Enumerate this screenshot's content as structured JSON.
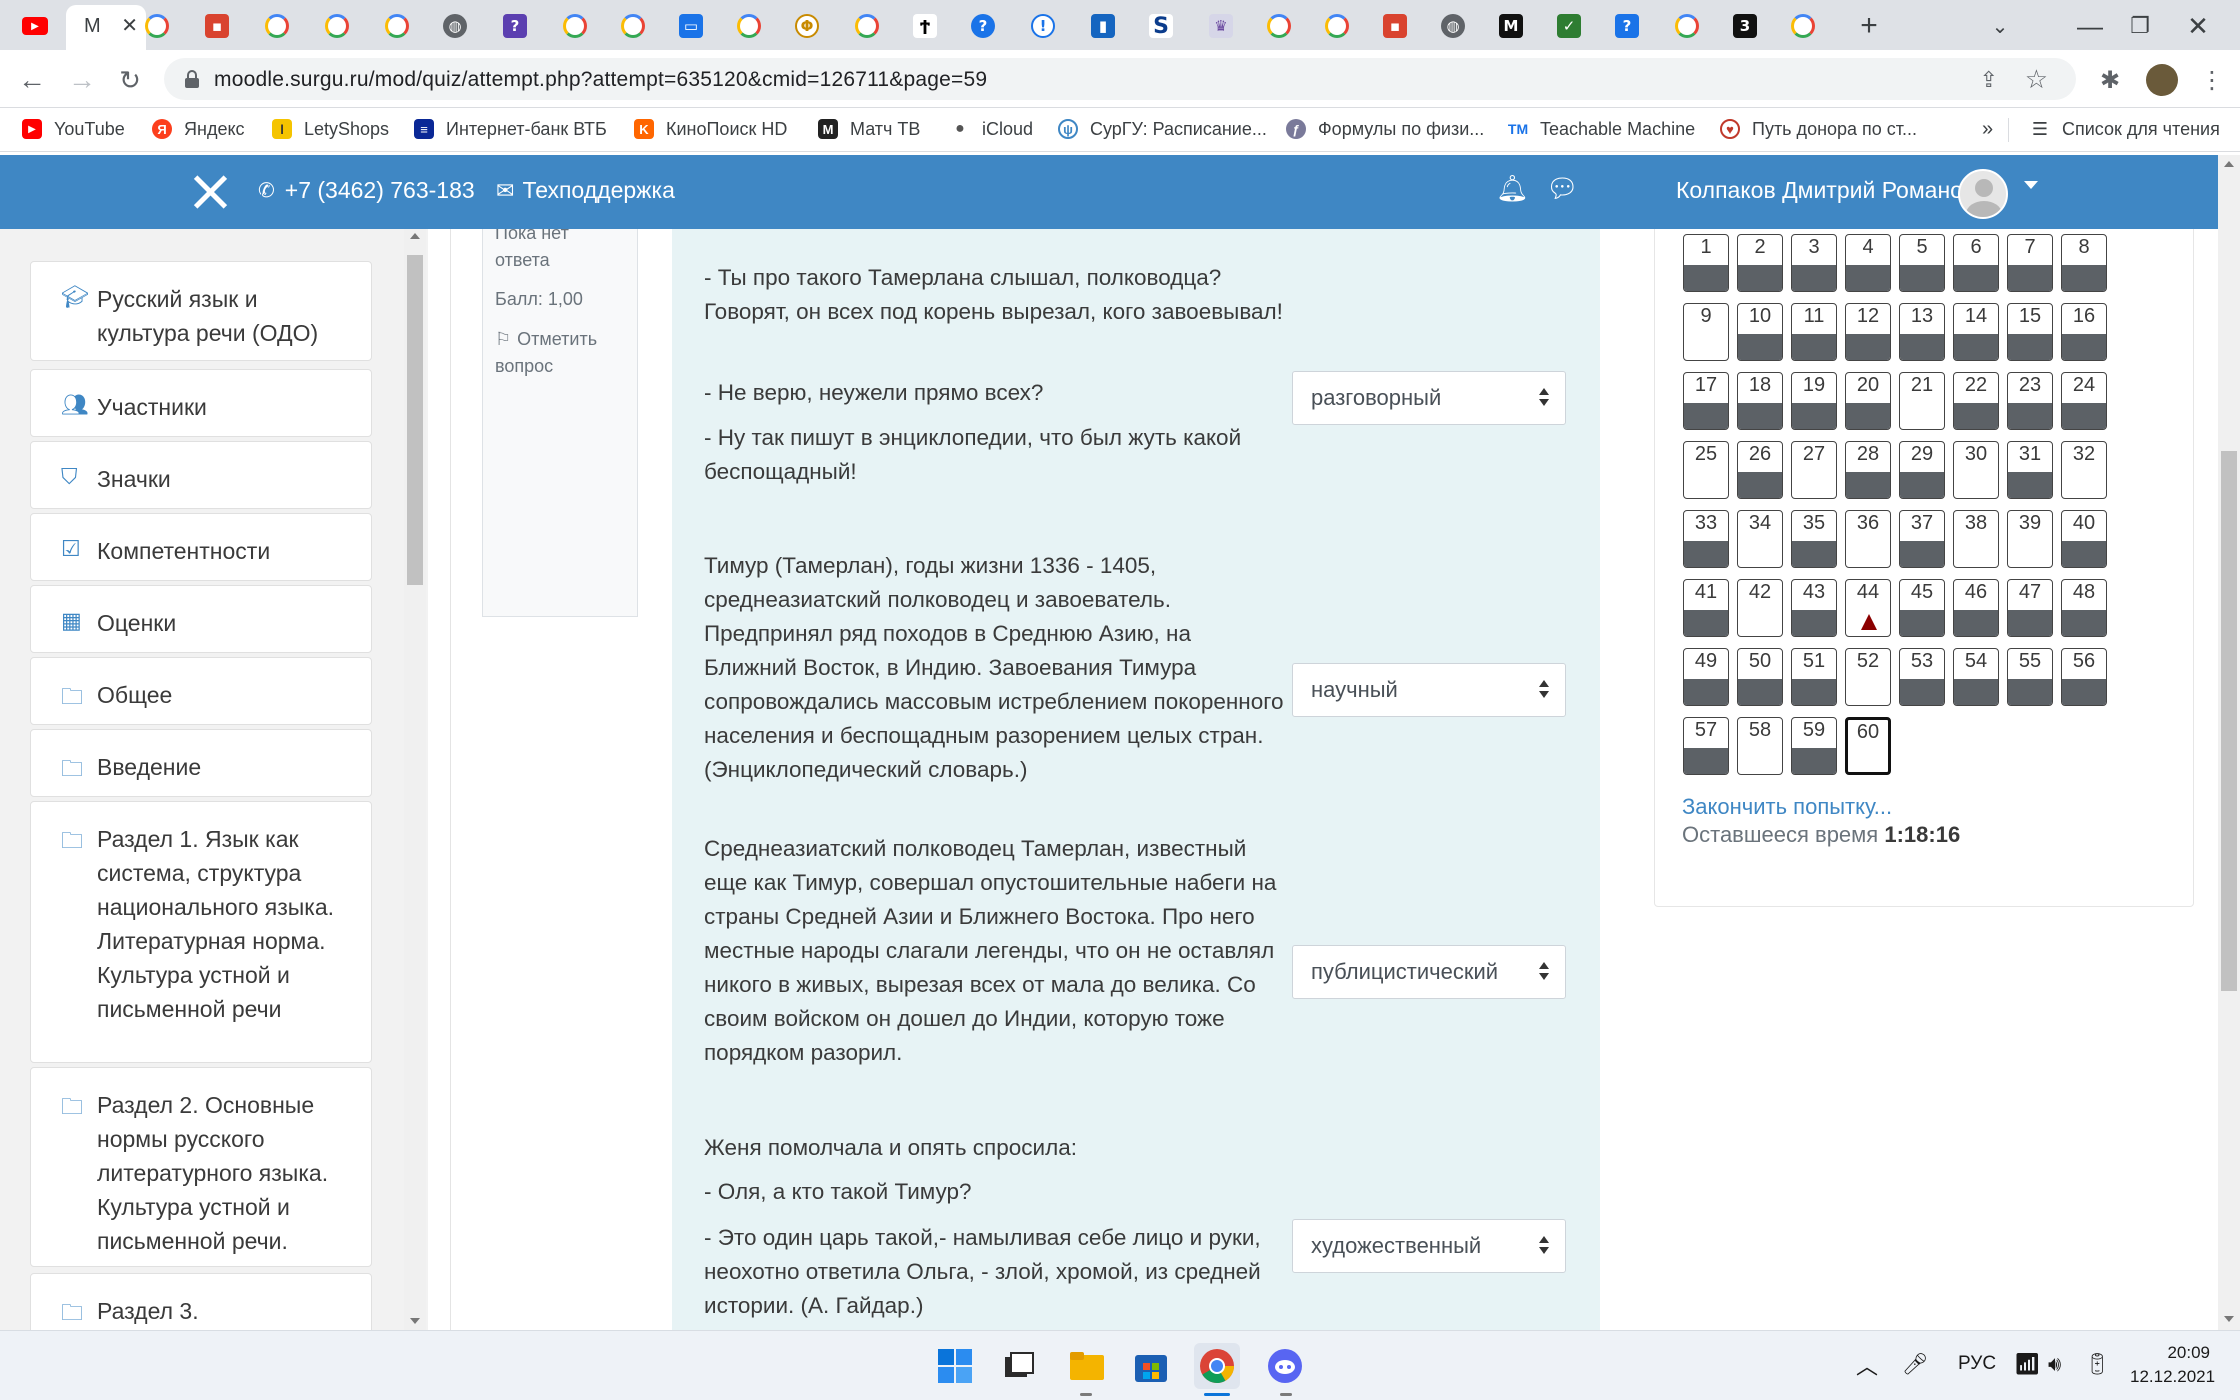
{
  "browser": {
    "url": "moodle.surgu.ru/mod/quiz/attempt.php?attempt=635120&cmid=126711&page=59",
    "active_tab_label": "М",
    "bookmarks": [
      {
        "label": "YouTube",
        "icon": "youtube-icon",
        "color": "#ff0000"
      },
      {
        "label": "Яндекс",
        "icon": "yandex-icon",
        "color": "#fc3f1d"
      },
      {
        "label": "LetyShops",
        "icon": "letyshops-icon",
        "color": "#f5c400"
      },
      {
        "label": "Интернет-банк ВТБ",
        "icon": "vtb-icon",
        "color": "#0a2896"
      },
      {
        "label": "КиноПоиск HD",
        "icon": "kinopoisk-icon",
        "color": "#ff6600"
      },
      {
        "label": "Матч ТВ",
        "icon": "matchtv-icon",
        "color": "#222222"
      },
      {
        "label": "iCloud",
        "icon": "apple-icon",
        "color": "#555555"
      },
      {
        "label": "СурГУ: Расписание...",
        "icon": "surgu-icon",
        "color": "#3f87c4"
      },
      {
        "label": "Формулы по физи...",
        "icon": "formula-icon",
        "color": "#7a7a9a"
      },
      {
        "label": "Teachable Machine",
        "icon": "teachable-icon",
        "color": "#1a73e8"
      },
      {
        "label": "Путь донора по ст...",
        "icon": "donor-icon",
        "color": "#c0392b"
      }
    ],
    "more_bookmarks": "»",
    "reading_list": "Список для чтения"
  },
  "navbar": {
    "phone": "+7 (3462) 763-183",
    "support": "Техподдержка",
    "user": "Колпаков Дмитрий Романович"
  },
  "sidebar": {
    "items": [
      {
        "label": "Русский язык и культура речи (ОДО)",
        "icon": "graduation-cap-icon"
      },
      {
        "label": "Участники",
        "icon": "users-icon"
      },
      {
        "label": "Значки",
        "icon": "shield-icon"
      },
      {
        "label": "Компетентности",
        "icon": "checkbox-icon"
      },
      {
        "label": "Оценки",
        "icon": "table-icon"
      },
      {
        "label": "Общее",
        "icon": "folder-icon"
      },
      {
        "label": "Введение",
        "icon": "folder-icon"
      },
      {
        "label": "Раздел 1. Язык как система, структура национального языка. Литературная норма. Культура устной и письменной речи",
        "icon": "folder-icon"
      },
      {
        "label": "Раздел 2. Основные нормы русского литературного языка. Культура устной и письменной речи.",
        "icon": "folder-icon"
      },
      {
        "label": "Раздел 3.",
        "icon": "folder-icon"
      }
    ]
  },
  "question_info": {
    "status_line1": "Пока нет",
    "status_line2": "ответа",
    "score": "Балл: 1,00",
    "flag_line1": "Отметить",
    "flag_line2": "вопрос"
  },
  "question": {
    "blocks": [
      {
        "paragraphs": [
          "- Ты про такого Тамерлана слышал, полководца? Говорят, он всех под корень вырезал, кого завоевывал!",
          "- Не верю, неужели прямо всех?",
          "- Ну так пишут в энциклопедии, что был жуть какой беспощадный!"
        ],
        "answer": "разговорный"
      },
      {
        "paragraphs": [
          "Тимур (Тамерлан), годы жизни 1336 - 1405, среднеазиатский полководец и завоеватель. Предпринял ряд походов в Среднюю Азию, на Ближний Восток, в Индию. Завоевания Тимура сопровождались массовым истреблением покоренного населения и беспощадным разорением целых стран. (Энциклопедический словарь.)"
        ],
        "answer": "научный"
      },
      {
        "paragraphs": [
          "Среднеазиатский полководец Тамерлан, известный еще как Тимур, совершал опустошительные набеги на страны Средней Азии и Ближнего Востока. Про него местные народы слагали легенды, что он не оставлял никого в живых, вырезая всех от мала до велика. Со своим войском он дошел до Индии, которую тоже порядком разорил."
        ],
        "answer": "публицистический"
      },
      {
        "paragraphs": [
          "Женя помолчала и опять спросила:",
          "- Оля, а кто такой Тимур?",
          "- Это один царь такой,- намыливая себе лицо и руки, неохотно ответила Ольга, - злой, хромой, из средней истории. (А. Гайдар.)"
        ],
        "answer": "художественный"
      }
    ]
  },
  "quiz_nav": {
    "questions": [
      {
        "n": "1",
        "state": "answered"
      },
      {
        "n": "2",
        "state": "answered"
      },
      {
        "n": "3",
        "state": "answered"
      },
      {
        "n": "4",
        "state": "answered"
      },
      {
        "n": "5",
        "state": "answered"
      },
      {
        "n": "6",
        "state": "answered"
      },
      {
        "n": "7",
        "state": "answered"
      },
      {
        "n": "8",
        "state": "answered"
      },
      {
        "n": "9",
        "state": "empty"
      },
      {
        "n": "10",
        "state": "answered"
      },
      {
        "n": "11",
        "state": "answered"
      },
      {
        "n": "12",
        "state": "answered"
      },
      {
        "n": "13",
        "state": "answered"
      },
      {
        "n": "14",
        "state": "answered"
      },
      {
        "n": "15",
        "state": "answered"
      },
      {
        "n": "16",
        "state": "answered"
      },
      {
        "n": "17",
        "state": "answered"
      },
      {
        "n": "18",
        "state": "answered"
      },
      {
        "n": "19",
        "state": "answered"
      },
      {
        "n": "20",
        "state": "answered"
      },
      {
        "n": "21",
        "state": "empty"
      },
      {
        "n": "22",
        "state": "answered"
      },
      {
        "n": "23",
        "state": "answered"
      },
      {
        "n": "24",
        "state": "answered"
      },
      {
        "n": "25",
        "state": "empty"
      },
      {
        "n": "26",
        "state": "answered"
      },
      {
        "n": "27",
        "state": "empty"
      },
      {
        "n": "28",
        "state": "answered"
      },
      {
        "n": "29",
        "state": "answered"
      },
      {
        "n": "30",
        "state": "empty"
      },
      {
        "n": "31",
        "state": "answered"
      },
      {
        "n": "32",
        "state": "empty"
      },
      {
        "n": "33",
        "state": "answered"
      },
      {
        "n": "34",
        "state": "empty"
      },
      {
        "n": "35",
        "state": "answered"
      },
      {
        "n": "36",
        "state": "empty"
      },
      {
        "n": "37",
        "state": "answered"
      },
      {
        "n": "38",
        "state": "empty"
      },
      {
        "n": "39",
        "state": "empty"
      },
      {
        "n": "40",
        "state": "answered"
      },
      {
        "n": "41",
        "state": "answered"
      },
      {
        "n": "42",
        "state": "empty"
      },
      {
        "n": "43",
        "state": "answered"
      },
      {
        "n": "44",
        "state": "flagged"
      },
      {
        "n": "45",
        "state": "answered"
      },
      {
        "n": "46",
        "state": "answered"
      },
      {
        "n": "47",
        "state": "answered"
      },
      {
        "n": "48",
        "state": "answered"
      },
      {
        "n": "49",
        "state": "answered"
      },
      {
        "n": "50",
        "state": "answered"
      },
      {
        "n": "51",
        "state": "answered"
      },
      {
        "n": "52",
        "state": "empty"
      },
      {
        "n": "53",
        "state": "answered"
      },
      {
        "n": "54",
        "state": "answered"
      },
      {
        "n": "55",
        "state": "answered"
      },
      {
        "n": "56",
        "state": "answered"
      },
      {
        "n": "57",
        "state": "answered"
      },
      {
        "n": "58",
        "state": "empty"
      },
      {
        "n": "59",
        "state": "answered"
      },
      {
        "n": "60",
        "state": "current"
      }
    ],
    "finish": "Закончить попытку...",
    "time_label": "Оставшееся время",
    "time_value": "1:18:16"
  },
  "taskbar": {
    "lang": "РУС",
    "time": "20:09",
    "date": "12.12.2021"
  },
  "colors": {
    "navbar": "#3f87c4",
    "question_bg": "#e7f3f5",
    "answered_fill": "#5c6166",
    "flag": "#8b0000"
  }
}
